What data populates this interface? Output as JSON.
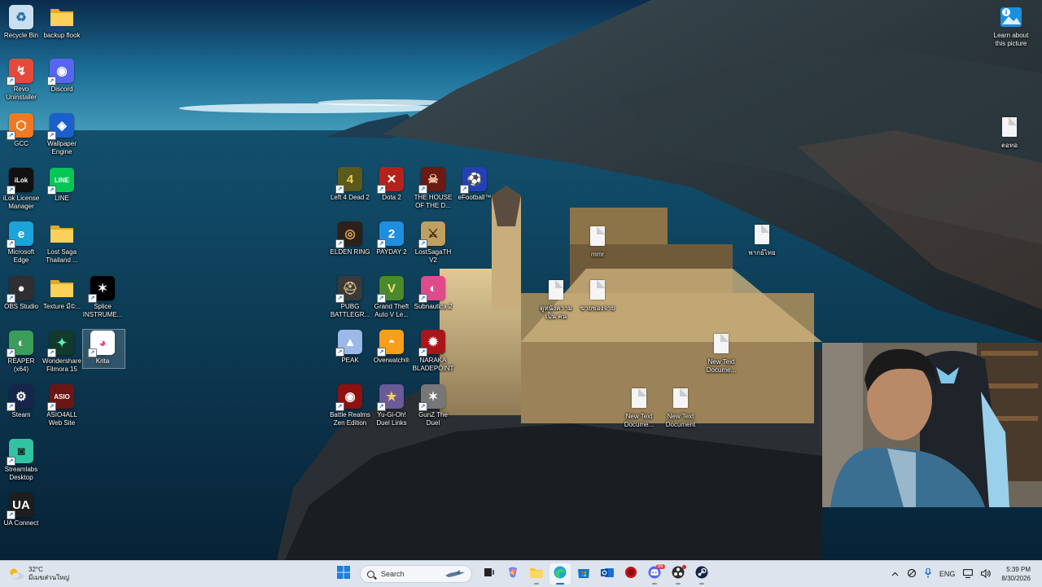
{
  "desktop": {
    "left_icons": [
      {
        "label": "Recycle Bin",
        "icon": "recycle-bin-icon"
      },
      {
        "label": "backup flook",
        "icon": "folder-icon"
      },
      {
        "label": "Revo Uninstaller",
        "icon": "revo-uninstaller-icon"
      },
      {
        "label": "Discord",
        "icon": "discord-icon"
      },
      {
        "label": "GCC",
        "icon": "gcc-icon"
      },
      {
        "label": "Wallpaper Engine",
        "icon": "wallpaper-engine-icon"
      },
      {
        "label": "iLok License Manager",
        "icon": "ilok-icon"
      },
      {
        "label": "LINE",
        "icon": "line-icon"
      },
      {
        "label": "Microsoft Edge",
        "icon": "edge-icon"
      },
      {
        "label": "Lost Saga Thailand ...",
        "icon": "folder-icon"
      },
      {
        "label": "OBS Studio",
        "icon": "obs-icon"
      },
      {
        "label": "Texture มี©...",
        "icon": "folder-icon"
      },
      {
        "label": "Splice INSTRUME...",
        "icon": "splice-icon"
      },
      {
        "label": "REAPER (x64)",
        "icon": "reaper-icon"
      },
      {
        "label": "Wondershare Filmora 15",
        "icon": "filmora-icon"
      },
      {
        "label": "Krita",
        "icon": "krita-icon"
      },
      {
        "label": "Steam",
        "icon": "steam-icon"
      },
      {
        "label": "ASIO4ALL Web Site",
        "icon": "asio4all-icon"
      },
      {
        "label": "Streamlabs Desktop",
        "icon": "streamlabs-icon"
      },
      {
        "label": "UA Connect",
        "icon": "ua-connect-icon"
      }
    ],
    "game_icons": [
      {
        "label": "Left 4 Dead 2",
        "icon": "left4dead2-icon"
      },
      {
        "label": "Dota 2",
        "icon": "dota2-icon"
      },
      {
        "label": "THE HOUSE OF THE D...",
        "icon": "house-of-the-dead-icon"
      },
      {
        "label": "eFootball™",
        "icon": "efootball-icon"
      },
      {
        "label": "ELDEN RING",
        "icon": "elden-ring-icon"
      },
      {
        "label": "PAYDAY 2",
        "icon": "payday2-icon"
      },
      {
        "label": "LostSagaTH V2",
        "icon": "lostsaga-icon"
      },
      {
        "label": "PUBG BATTLEGR...",
        "icon": "pubg-icon"
      },
      {
        "label": "Grand Theft Auto V Le...",
        "icon": "gta5-icon"
      },
      {
        "label": "Subnautica 2",
        "icon": "subnautica-icon"
      },
      {
        "label": "PEAK",
        "icon": "peak-icon"
      },
      {
        "label": "Overwatch®",
        "icon": "overwatch-icon"
      },
      {
        "label": "NARAKA BLADEPOINT",
        "icon": "naraka-icon"
      },
      {
        "label": "Battle Realms Zen Edition",
        "icon": "battle-realms-icon"
      },
      {
        "label": "Yu-Gi-Oh! Duel Links",
        "icon": "yugioh-icon"
      },
      {
        "label": "GunZ The Duel",
        "icon": "gunz-icon"
      }
    ],
    "files": [
      {
        "label": "mmr"
      },
      {
        "label": "ดูหนังความเป็น คน"
      },
      {
        "label": "ขายของจาย"
      },
      {
        "label": "พากย์ไทย"
      },
      {
        "label": "New Text Docume..."
      },
      {
        "label": "New Text Docume..."
      },
      {
        "label": "New Text Document"
      },
      {
        "label": "ตอทอ"
      }
    ],
    "learn_label": "Learn about this picture"
  },
  "taskbar": {
    "weather_temp": "32°C",
    "weather_desc": "มีเมฆส่วนใหญ่",
    "search_placeholder": "Search",
    "apps": [
      {
        "name": "start-button",
        "icon": "windows-icon"
      },
      {
        "name": "search-box"
      },
      {
        "name": "task-view-button",
        "icon": "task-view-icon"
      },
      {
        "name": "copilot-button",
        "icon": "copilot-icon"
      },
      {
        "name": "file-explorer-button",
        "icon": "folder-icon"
      },
      {
        "name": "edge-button",
        "icon": "edge-icon"
      },
      {
        "name": "store-button",
        "icon": "store-icon"
      },
      {
        "name": "outlook-button",
        "icon": "outlook-icon"
      },
      {
        "name": "record-button",
        "icon": "record-icon"
      },
      {
        "name": "discord-button",
        "icon": "discord-icon"
      },
      {
        "name": "obs-button",
        "icon": "obs-icon"
      },
      {
        "name": "steam-button",
        "icon": "steam-icon"
      }
    ],
    "tray": {
      "language": "ENG",
      "time": "5:39 PM",
      "date": "8/30/2026",
      "discord_badge": "99"
    }
  }
}
